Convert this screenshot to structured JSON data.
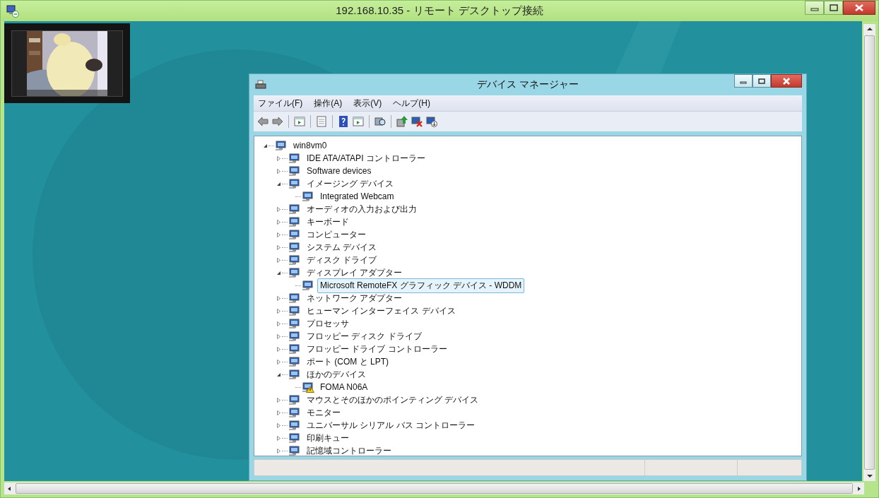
{
  "remote_window": {
    "title": "192.168.10.35 - リモート デスクトップ接続"
  },
  "device_manager": {
    "title": "デバイス マネージャー",
    "menu": [
      "ファイル(F)",
      "操作(A)",
      "表示(V)",
      "ヘルプ(H)"
    ],
    "tree": {
      "label": "win8vm0",
      "expanded": true,
      "selected": false,
      "children": [
        {
          "label": "IDE ATA/ATAPI コントローラー",
          "expanded": false,
          "selected": false
        },
        {
          "label": "Software devices",
          "expanded": false,
          "selected": false
        },
        {
          "label": "イメージング デバイス",
          "expanded": true,
          "selected": false,
          "children": [
            {
              "label": "Integrated Webcam",
              "selected": false,
              "warning": false
            }
          ]
        },
        {
          "label": "オーディオの入力および出力",
          "expanded": false,
          "selected": false
        },
        {
          "label": "キーボード",
          "expanded": false,
          "selected": false
        },
        {
          "label": "コンピューター",
          "expanded": false,
          "selected": false
        },
        {
          "label": "システム デバイス",
          "expanded": false,
          "selected": false
        },
        {
          "label": "ディスク ドライブ",
          "expanded": false,
          "selected": false
        },
        {
          "label": "ディスプレイ アダプター",
          "expanded": true,
          "selected": false,
          "children": [
            {
              "label": "Microsoft RemoteFX グラフィック デバイス - WDDM",
              "selected": true,
              "warning": false
            }
          ]
        },
        {
          "label": "ネットワーク アダプター",
          "expanded": false,
          "selected": false
        },
        {
          "label": "ヒューマン インターフェイス デバイス",
          "expanded": false,
          "selected": false
        },
        {
          "label": "プロセッサ",
          "expanded": false,
          "selected": false
        },
        {
          "label": "フロッピー ディスク ドライブ",
          "expanded": false,
          "selected": false
        },
        {
          "label": "フロッピー ドライブ コントローラー",
          "expanded": false,
          "selected": false
        },
        {
          "label": "ポート (COM と LPT)",
          "expanded": false,
          "selected": false
        },
        {
          "label": "ほかのデバイス",
          "expanded": true,
          "selected": false,
          "children": [
            {
              "label": "FOMA N06A",
              "selected": false,
              "warning": true
            }
          ]
        },
        {
          "label": "マウスとそのほかのポインティング デバイス",
          "expanded": false,
          "selected": false
        },
        {
          "label": "モニター",
          "expanded": false,
          "selected": false
        },
        {
          "label": "ユニバーサル シリアル バス コントローラー",
          "expanded": false,
          "selected": false
        },
        {
          "label": "印刷キュー",
          "expanded": false,
          "selected": false
        },
        {
          "label": "記憶域コントローラー",
          "expanded": false,
          "selected": false
        }
      ]
    }
  }
}
